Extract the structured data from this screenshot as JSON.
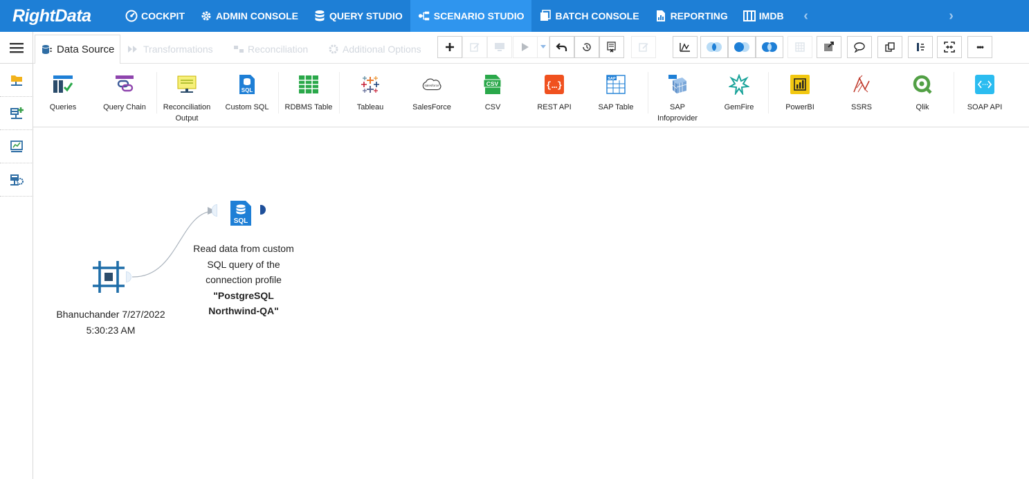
{
  "brand": {
    "logo_text": "RightData",
    "accent": "#1e7fd6",
    "active_tab_bg": "#2f95ee"
  },
  "topnav": {
    "items": [
      {
        "label": "COCKPIT",
        "icon": "gauge-icon"
      },
      {
        "label": "ADMIN CONSOLE",
        "icon": "gear-icon"
      },
      {
        "label": "QUERY STUDIO",
        "icon": "database-icon"
      },
      {
        "label": "SCENARIO STUDIO",
        "icon": "scenario-icon",
        "active": true
      },
      {
        "label": "BATCH CONSOLE",
        "icon": "batch-icon"
      },
      {
        "label": "REPORTING",
        "icon": "report-icon"
      },
      {
        "label": "IMDB",
        "icon": "imdb-icon"
      }
    ],
    "prev_arrow": "‹",
    "next_arrow": "›"
  },
  "tabs": {
    "data_source": "Data Source",
    "transformations": "Transformations",
    "reconciliation": "Reconciliation",
    "additional_options": "Additional Options"
  },
  "toolbar": {
    "icons": [
      "add-icon",
      "edit-icon",
      "monitor-icon",
      "run-icon",
      "run-dropdown-icon",
      "undo-icon",
      "history-icon",
      "report-icon",
      "notes-icon",
      "chart-icon",
      "left-join-icon",
      "inner-join-icon",
      "outer-join-icon",
      "grid-icon",
      "export-icon",
      "comment-icon",
      "copy-icon",
      "split-icon",
      "compare-icon",
      "more-icon"
    ],
    "more_label": "•••"
  },
  "palette": {
    "items": [
      {
        "label": "Queries",
        "icon": "queries-icon"
      },
      {
        "label": "Query Chain",
        "icon": "query-chain-icon"
      },
      {
        "label": "Reconciliation\nOutput",
        "icon": "reconciliation-output-icon"
      },
      {
        "label": "Custom SQL",
        "icon": "custom-sql-icon"
      },
      {
        "label": "RDBMS Table",
        "icon": "rdbms-table-icon"
      },
      {
        "label": "Tableau",
        "icon": "tableau-icon"
      },
      {
        "label": "SalesForce",
        "icon": "salesforce-icon"
      },
      {
        "label": "CSV",
        "icon": "csv-icon"
      },
      {
        "label": "REST API",
        "icon": "rest-api-icon"
      },
      {
        "label": "SAP Table",
        "icon": "sap-table-icon"
      },
      {
        "label": "SAP\nInfoprovider",
        "icon": "sap-infoprovider-icon"
      },
      {
        "label": "GemFire",
        "icon": "gemfire-icon"
      },
      {
        "label": "PowerBI",
        "icon": "powerbi-icon"
      },
      {
        "label": "SSRS",
        "icon": "ssrs-icon"
      },
      {
        "label": "Qlik",
        "icon": "qlik-icon"
      },
      {
        "label": "SOAP API",
        "icon": "soap-api-icon"
      }
    ]
  },
  "canvas": {
    "start_node": {
      "label_line1": "Bhanuchander 7/27/2022",
      "label_line2": "5:30:23 AM"
    },
    "sql_node": {
      "icon_text": "SQL",
      "desc_line1": "Read data from custom",
      "desc_line2": "SQL query of the",
      "desc_line3": "connection profile",
      "profile_line1": "\"PostgreSQL",
      "profile_line2": "Northwind-QA\""
    }
  }
}
